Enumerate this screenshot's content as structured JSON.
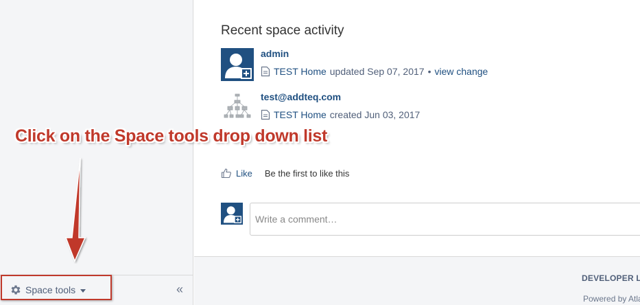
{
  "sidebar": {
    "space_tools_label": "Space tools",
    "collapse_glyph": "«",
    "icons": {
      "tools": "gear-icon",
      "caret": "chevron-down-icon",
      "collapse": "double-chevron-left-icon"
    }
  },
  "activity": {
    "title": "Recent space activity",
    "items": [
      {
        "author": "admin",
        "page": "TEST Home",
        "action": "updated Sep 07, 2017",
        "separator": "•",
        "extra_link": "view change"
      },
      {
        "author": "test@addteq.com",
        "page": "TEST Home",
        "action": "created Jun 03, 2017"
      }
    ]
  },
  "like": {
    "button_label": "Like",
    "status_text": "Be the first to like this"
  },
  "comment": {
    "placeholder": "Write a comment…"
  },
  "footer": {
    "title": "DEVELOPER L",
    "powered": "Powered by Atla"
  },
  "annotation": {
    "text": "Click on the Space tools drop down list"
  },
  "colors": {
    "link": "#205081",
    "annotation": "#c0392b",
    "sidebar_bg": "#f4f5f7",
    "avatar_bg": "#205081"
  }
}
